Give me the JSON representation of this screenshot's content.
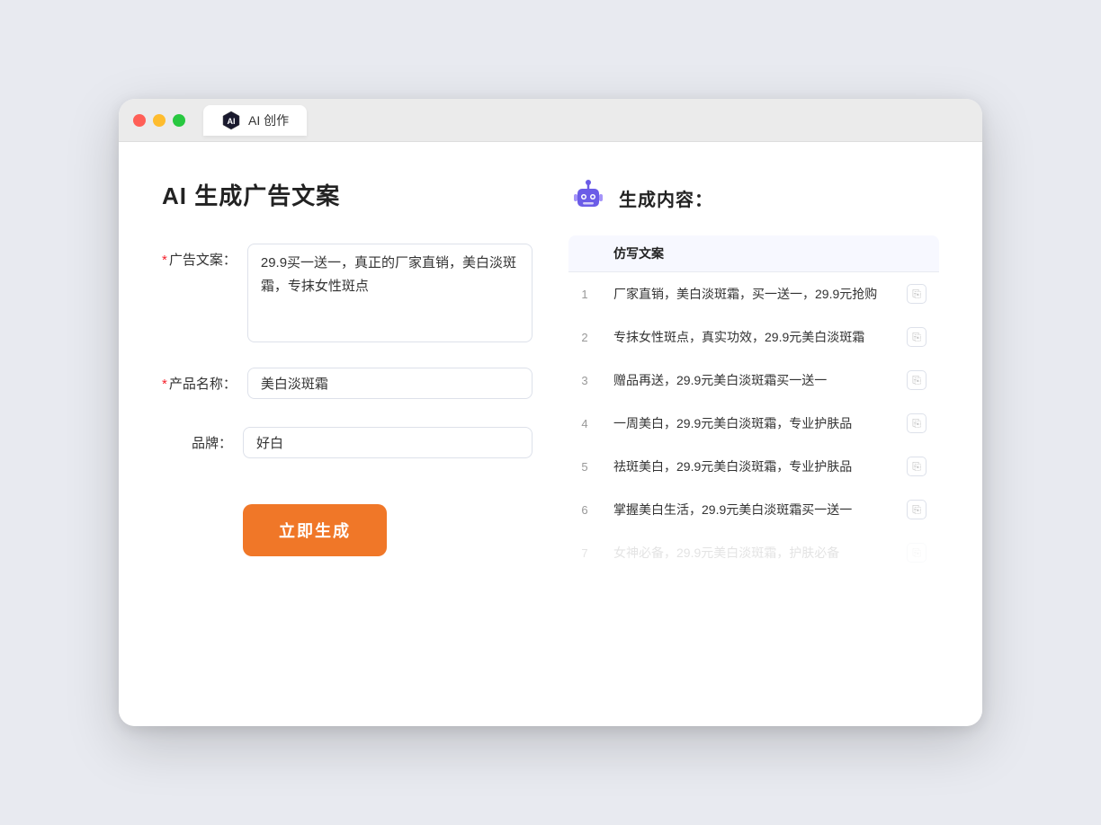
{
  "browser": {
    "tab_label": "AI 创作",
    "traffic_lights": [
      "red",
      "yellow",
      "green"
    ]
  },
  "left_panel": {
    "title": "AI 生成广告文案",
    "fields": [
      {
        "label": "广告文案：",
        "required": true,
        "type": "textarea",
        "value": "29.9买一送一，真正的厂家直销，美白淡斑霜，专抹女性斑点",
        "placeholder": ""
      },
      {
        "label": "产品名称：",
        "required": true,
        "type": "input",
        "value": "美白淡斑霜",
        "placeholder": ""
      },
      {
        "label": "品牌：",
        "required": false,
        "type": "input",
        "value": "好白",
        "placeholder": ""
      }
    ],
    "generate_button": "立即生成"
  },
  "right_panel": {
    "title": "生成内容：",
    "table_header": "仿写文案",
    "results": [
      {
        "num": 1,
        "text": "厂家直销，美白淡斑霜，买一送一，29.9元抢购"
      },
      {
        "num": 2,
        "text": "专抹女性斑点，真实功效，29.9元美白淡斑霜"
      },
      {
        "num": 3,
        "text": "赠品再送，29.9元美白淡斑霜买一送一"
      },
      {
        "num": 4,
        "text": "一周美白，29.9元美白淡斑霜，专业护肤品"
      },
      {
        "num": 5,
        "text": "祛斑美白，29.9元美白淡斑霜，专业护肤品"
      },
      {
        "num": 6,
        "text": "掌握美白生活，29.9元美白淡斑霜买一送一"
      },
      {
        "num": 7,
        "text": "女神必备，29.9元美白淡斑霜，护肤必备",
        "faded": true
      }
    ]
  }
}
